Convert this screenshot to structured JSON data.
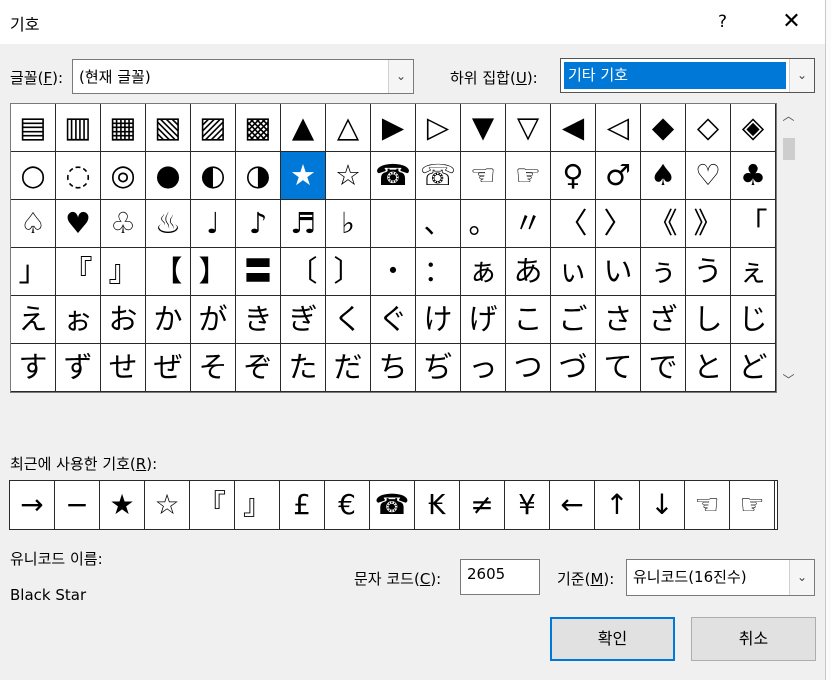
{
  "window": {
    "title": "기호",
    "help_label": "?",
    "close_label": "✕"
  },
  "font": {
    "label": "글꼴(",
    "key": "F",
    "label_end": "):",
    "value": "(현재 글꼴)"
  },
  "subset": {
    "label": "하위 집합(",
    "key": "U",
    "label_end": "):",
    "value": "기타 기호"
  },
  "symbols": [
    "▤",
    "▥",
    "▦",
    "▧",
    "▨",
    "▩",
    "▲",
    "△",
    "▶",
    "▷",
    "▼",
    "▽",
    "◀",
    "◁",
    "◆",
    "◇",
    "◈",
    "○",
    "◌",
    "◎",
    "●",
    "◐",
    "◑",
    "★",
    "☆",
    "☎",
    "☏",
    "☜",
    "☞",
    "♀",
    "♂",
    "♠",
    "♡",
    "♣",
    "♤",
    "♥",
    "♧",
    "♨",
    "♩",
    "♪",
    "♬",
    "♭",
    "",
    "、",
    "。",
    "〃",
    "〈",
    "〉",
    "《",
    "》",
    "「",
    "」",
    "『",
    "』",
    "【",
    "】",
    "〓",
    "〔",
    "〕",
    "・",
    "：",
    "ぁ",
    "あ",
    "ぃ",
    "い",
    "ぅ",
    "う",
    "ぇ",
    "え",
    "ぉ",
    "お",
    "か",
    "が",
    "き",
    "ぎ",
    "く",
    "ぐ",
    "け",
    "げ",
    "こ",
    "ご",
    "さ",
    "ざ",
    "し",
    "じ",
    "す",
    "ず",
    "せ",
    "ぜ",
    "そ",
    "ぞ",
    "た",
    "だ",
    "ち",
    "ぢ",
    "っ",
    "つ",
    "づ",
    "て",
    "で",
    "と",
    "ど"
  ],
  "selected_symbol": "★",
  "recent": {
    "label": "최근에 사용한 기호(",
    "key": "R",
    "label_end": "):",
    "items": [
      "→",
      "−",
      "★",
      "☆",
      "『",
      "』",
      "£",
      "€",
      "☎",
      "₭",
      "≠",
      "¥",
      "←",
      "↑",
      "↓",
      "☜",
      "☞"
    ]
  },
  "unicode_name": {
    "label": "유니코드 이름:",
    "value": "Black Star"
  },
  "char_code": {
    "label": "문자 코드(",
    "key": "C",
    "label_end": "):",
    "value": "2605"
  },
  "basis": {
    "label": "기준(",
    "key": "M",
    "label_end": "):",
    "value": "유니코드(16진수)"
  },
  "buttons": {
    "ok": "확인",
    "cancel": "취소"
  },
  "scroll": {
    "up": "︿",
    "down": "﹀"
  },
  "colors": {
    "selection": "#0078d7",
    "background": "#f0f0f0"
  }
}
